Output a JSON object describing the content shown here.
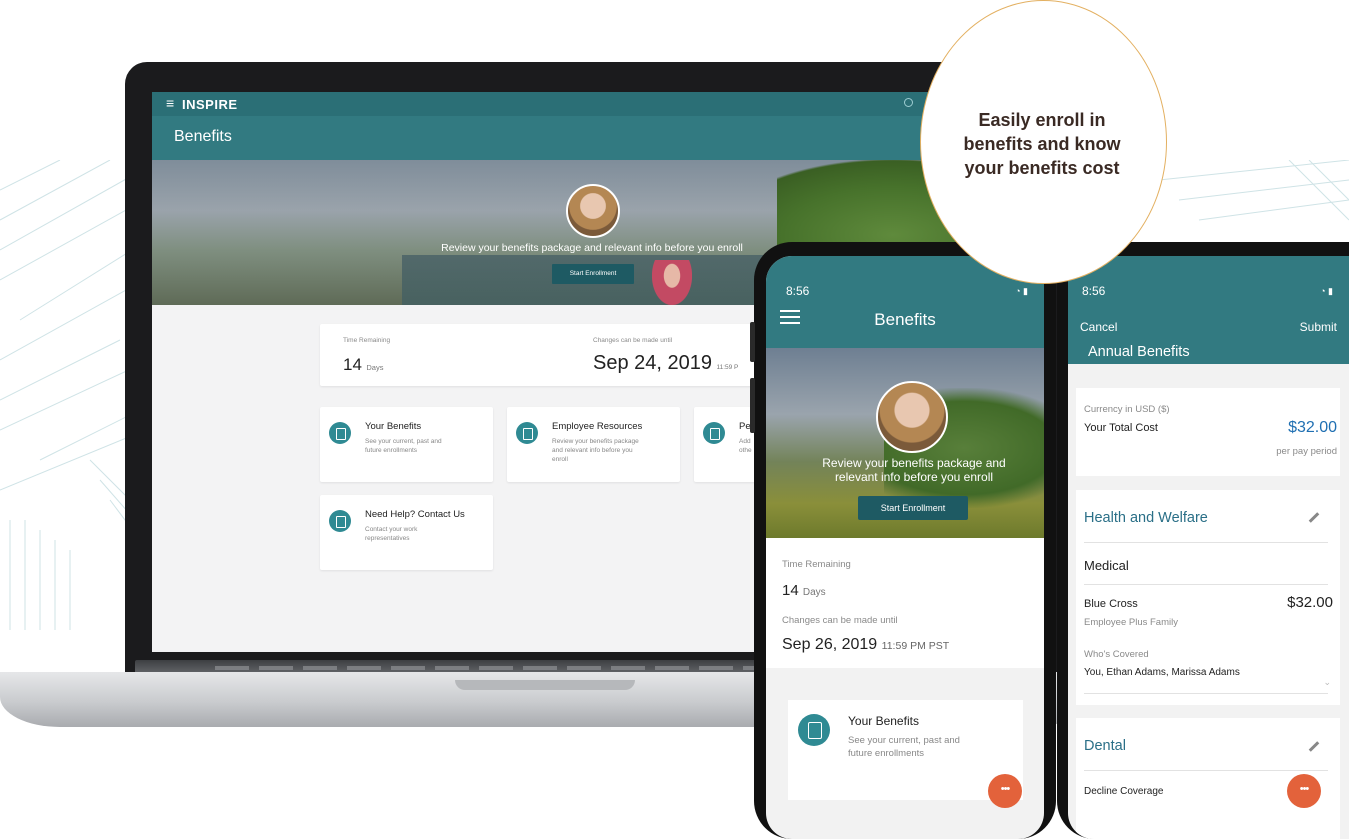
{
  "callout": {
    "line1": "Easily enroll in",
    "line2": "benefits and know",
    "line3": "your benefits cost"
  },
  "laptop": {
    "brand": "INSPIRE",
    "page_title": "Benefits",
    "hero_text": "Review your benefits package and relevant info before you enroll",
    "start_button": "Start Enrollment",
    "time_remaining_label": "Time Remaining",
    "days_value": "14",
    "days_unit": "Days",
    "changes_label": "Changes can be made until",
    "deadline_date": "Sep 24, 2019",
    "deadline_time": "11:59 P",
    "tiles": [
      {
        "title": "Your Benefits",
        "desc1": "See your current, past and",
        "desc2": "future enrollments"
      },
      {
        "title": "Employee Resources",
        "desc1": "Review your benefits package",
        "desc2": "and relevant info before you",
        "desc3": "enroll"
      },
      {
        "title": "Pe",
        "desc1": "Add",
        "desc2": "othe"
      },
      {
        "title": "Need Help? Contact Us",
        "desc1": "Contact your work",
        "desc2": "representatives"
      }
    ]
  },
  "phone1": {
    "clock": "8:56",
    "title": "Benefits",
    "hero_line1": "Review your benefits package and",
    "hero_line2": "relevant info before you enroll",
    "start_button": "Start Enrollment",
    "time_remaining_label": "Time Remaining",
    "days_value": "14",
    "days_unit": "Days",
    "changes_label": "Changes can be made until",
    "deadline_date": "Sep 26, 2019",
    "deadline_time": "11:59 PM PST",
    "card_title": "Your Benefits",
    "card_desc1": "See your current, past and",
    "card_desc2": "future enrollments"
  },
  "phone2": {
    "clock": "8:56",
    "cancel": "Cancel",
    "submit": "Submit",
    "title": "Annual Benefits",
    "currency_label": "Currency in USD ($)",
    "total_label": "Your Total Cost",
    "total_value": "$32.00",
    "per_period": "per pay period",
    "section1": "Health and Welfare",
    "medical": "Medical",
    "plan_name": "Blue Cross",
    "plan_price": "$32.00",
    "plan_tier": "Employee Plus Family",
    "whos_covered_label": "Who's Covered",
    "whos_covered": "You, Ethan Adams, Marissa Adams",
    "section2": "Dental",
    "decline": "Decline Coverage"
  },
  "colors": {
    "teal_header": "#327a81",
    "teal_dark": "#1e5a63",
    "accent_orange": "#e3623b",
    "price_blue": "#1f6fb2",
    "callout_border": "#e3b061"
  }
}
